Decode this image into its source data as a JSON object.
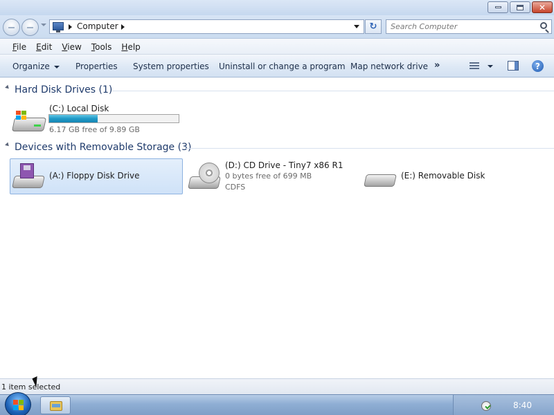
{
  "window": {
    "minimize_icon": "minimize-icon",
    "maximize_icon": "restore-icon",
    "close_icon": "close-icon",
    "close_glyph": "✕"
  },
  "address": {
    "location": "Computer",
    "refresh_glyph": "↻"
  },
  "search": {
    "placeholder": "Search Computer"
  },
  "menu": {
    "items": [
      {
        "label_first": "F",
        "label_rest": "ile"
      },
      {
        "label_first": "E",
        "label_rest": "dit"
      },
      {
        "label_first": "V",
        "label_rest": "iew"
      },
      {
        "label_first": "T",
        "label_rest": "ools"
      },
      {
        "label_first": "H",
        "label_rest": "elp"
      }
    ]
  },
  "commands": {
    "organize": "Organize",
    "properties": "Properties",
    "system_properties": "System properties",
    "uninstall": "Uninstall or change a program",
    "map_network_drive": "Map network drive",
    "more": "»",
    "help_glyph": "?"
  },
  "groups": {
    "hard_disk": {
      "title": "Hard Disk Drives (1)",
      "drive": {
        "name": "(C:) Local Disk",
        "free_text": "6.17 GB free of 9.89 GB",
        "used_fraction": 0.376
      }
    },
    "removable": {
      "title": "Devices with Removable Storage (3)",
      "drives": [
        {
          "name": "(A:) Floppy Disk Drive"
        },
        {
          "name": "(D:) CD Drive - Tiny7 x86 R1",
          "free_text": "0 bytes free of 699 MB",
          "fs": "CDFS"
        },
        {
          "name": "(E:) Removable Disk"
        }
      ]
    }
  },
  "status": {
    "text": "1 item selected"
  },
  "taskbar": {
    "time": "8:40"
  },
  "colors": {
    "accent": "#1f9ac7",
    "selection": "#cfe2f8",
    "group_title": "#1e3a6b"
  }
}
